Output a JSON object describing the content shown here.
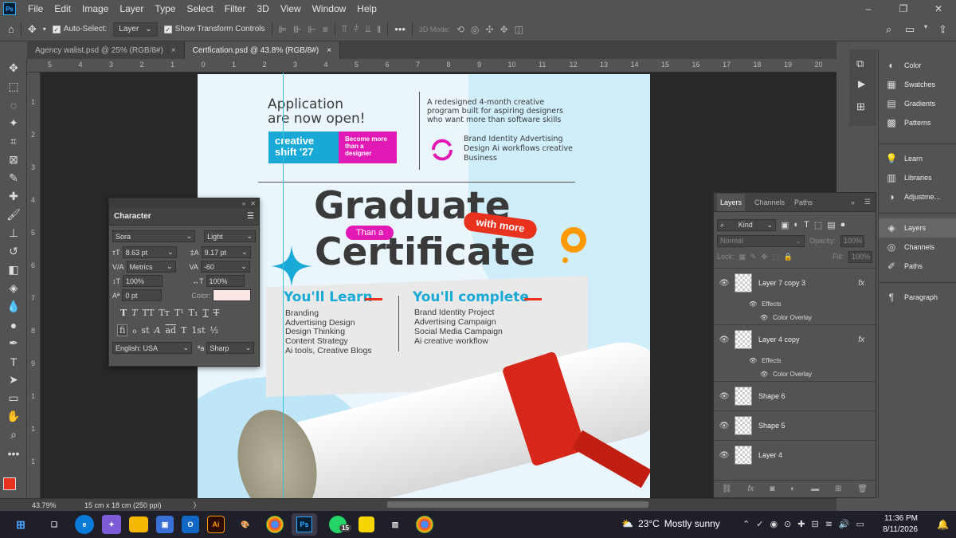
{
  "app": {
    "logo": "Ps"
  },
  "menubar": {
    "items": [
      "File",
      "Edit",
      "Image",
      "Layer",
      "Type",
      "Select",
      "Filter",
      "3D",
      "View",
      "Window",
      "Help"
    ],
    "window_controls": [
      "–",
      "❐",
      "✕"
    ]
  },
  "options": {
    "auto_select_label": "Auto-Select:",
    "auto_select_value": "Layer",
    "show_transform_label": "Show Transform Controls",
    "mode_3d_label": "3D Mode:",
    "more_label": "•••"
  },
  "tabs": [
    {
      "label": "Agency walist.psd @ 25% (RGB/8#)",
      "close": "×"
    },
    {
      "label": "Certfication.psd @ 43.8% (RGB/8#)",
      "close": "×"
    }
  ],
  "ruler_h": [
    "5",
    "4",
    "3",
    "2",
    "1",
    "0",
    "1",
    "2",
    "3",
    "4",
    "5",
    "6",
    "7",
    "8",
    "9",
    "10",
    "11",
    "12",
    "13",
    "14",
    "15",
    "16",
    "17",
    "18",
    "19",
    "20"
  ],
  "ruler_v": [
    "1",
    "2",
    "3",
    "4",
    "5",
    "6",
    "7",
    "8",
    "9",
    "1",
    "1",
    "1"
  ],
  "character": {
    "title": "Character",
    "font": "Sora",
    "style": "Light",
    "size": "8.63 pt",
    "leading": "9.17 pt",
    "kerning": "Metrics",
    "tracking": "-60",
    "v_scale": "100%",
    "h_scale": "100%",
    "baseline": "0 pt",
    "color_label": "Color:",
    "row1": [
      "T",
      "T",
      "TT",
      "Tт",
      "T¹",
      "T₁",
      "T",
      "T"
    ],
    "row2": [
      "fi",
      "ℴ",
      "st",
      "A",
      "ad",
      "T",
      "1st",
      "½"
    ],
    "language": "English: USA",
    "aa_label": "ªa",
    "antialias": "Sharp",
    "text_color": "#fde6e6"
  },
  "layers": {
    "tabs": [
      "Layers",
      "Channels",
      "Paths"
    ],
    "kind": "Kind",
    "blend": "Normal",
    "opacity_label": "Opacity:",
    "opacity": "100%",
    "lock_label": "Lock:",
    "fill_label": "Fill:",
    "fill": "100%",
    "items": [
      {
        "name": "Layer 7 copy 3",
        "fx": "fx",
        "effects": "Effects",
        "effect": "Color Overlay"
      },
      {
        "name": "Layer 4 copy",
        "fx": "fx",
        "effects": "Effects",
        "effect": "Color Overlay"
      },
      {
        "name": "Shape 6"
      },
      {
        "name": "Shape 5"
      },
      {
        "name": "Layer 4"
      }
    ]
  },
  "right_panel": {
    "group1": [
      "Color",
      "Swatches",
      "Gradients",
      "Patterns"
    ],
    "group2": [
      "Learn",
      "Libraries",
      "Adjustme..."
    ],
    "group3": [
      "Layers",
      "Channels",
      "Paths"
    ],
    "group4": [
      "Paragraph"
    ]
  },
  "status": {
    "zoom": "43.79%",
    "doc_size": "15 cm x 18 cm (250 ppi)",
    "arrow": "〉"
  },
  "document": {
    "headline1": "Application",
    "headline2": "are now open!",
    "badge_main": "creative shift '27",
    "badge_side": "Become more than a designer",
    "desc": "A redesigned 4-month creative program built for aspiring designers who want more than software skills",
    "tags": "Brand Identity Advertising Design Ai workflows creative Business",
    "graduate": "Graduate",
    "than_a": "Than a",
    "with_more": "with more",
    "certificate": "Certificate",
    "learn_title": "You'll Learn",
    "learn_items": [
      "Branding",
      "Advertising Design",
      "Design Thinking",
      "Content Strategy",
      "Ai tools, Creative Blogs"
    ],
    "complete_title": "You'll complete",
    "complete_items": [
      "Brand Identity Project",
      "Advertising Campaign",
      "Social Media Campaign",
      "Ai creative workflow"
    ]
  },
  "taskbar": {
    "weather_temp": "23°C",
    "weather_desc": "Mostly sunny",
    "time": "11:36 PM",
    "date": "8/11/2026",
    "wa_badge": "15"
  },
  "colors": {
    "accent_cyan": "#19a9d6",
    "magenta": "#e21ab5",
    "red": "#e8321e",
    "orange": "#ff9900",
    "fg_swatch": "#e8321e",
    "bg_swatch": "#5fa000"
  }
}
